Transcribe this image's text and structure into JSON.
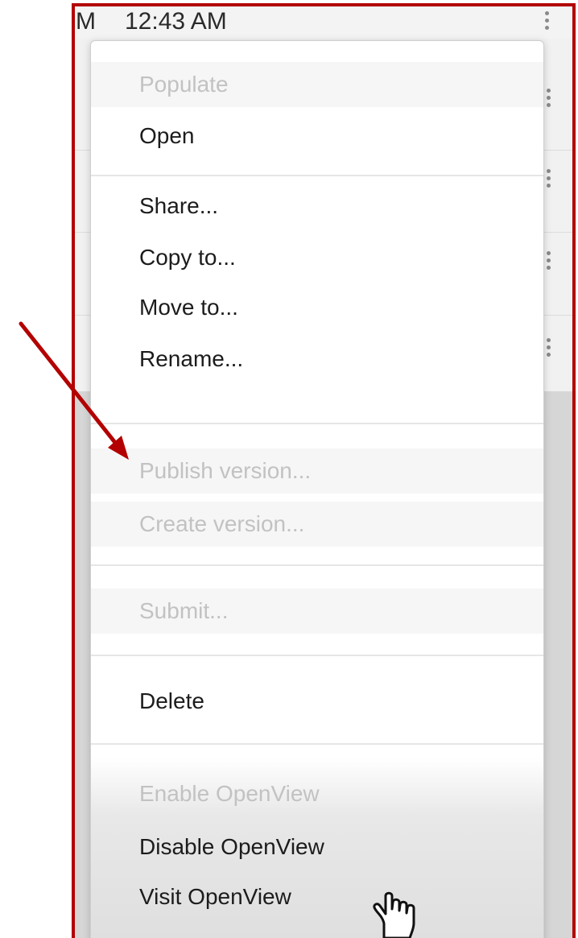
{
  "status_bar": {
    "time_prefix": "M",
    "time": "12:43 AM"
  },
  "context_menu": {
    "items": [
      {
        "label": "Populate",
        "enabled": false
      },
      {
        "label": "Open",
        "enabled": true
      },
      {
        "label": "Share...",
        "enabled": true
      },
      {
        "label": "Copy to...",
        "enabled": true
      },
      {
        "label": "Move to...",
        "enabled": true
      },
      {
        "label": "Rename...",
        "enabled": true
      },
      {
        "label": "Publish version...",
        "enabled": false
      },
      {
        "label": "Create version...",
        "enabled": false
      },
      {
        "label": "Submit...",
        "enabled": false
      },
      {
        "label": "Delete",
        "enabled": true
      },
      {
        "label": "Enable OpenView",
        "enabled": false
      },
      {
        "label": "Disable OpenView",
        "enabled": true
      },
      {
        "label": "Visit OpenView",
        "enabled": true
      }
    ]
  },
  "icons": {
    "row_menu": "kebab-menu-icon",
    "annotation": "red-arrow-icon",
    "cursor": "hand-pointer-icon"
  },
  "colors": {
    "frame": "#b30000",
    "enabled_text": "#1c1c1c",
    "disabled_text": "#c2c2c2"
  }
}
